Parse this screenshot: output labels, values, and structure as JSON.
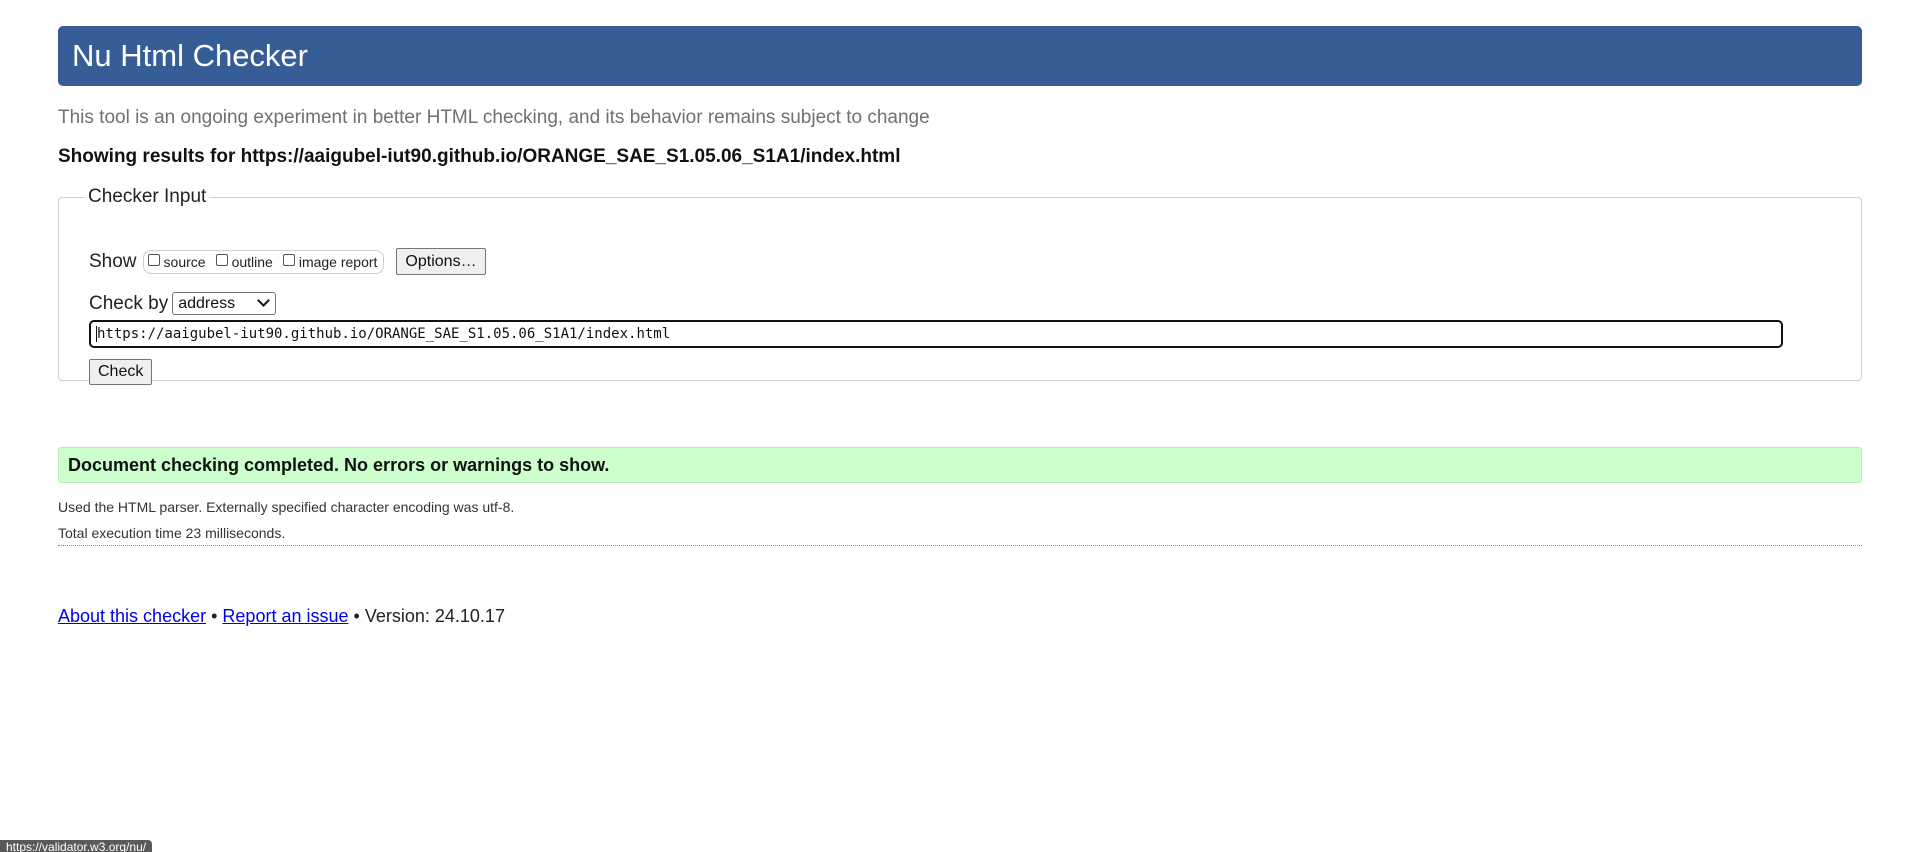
{
  "header": {
    "title": "Nu Html Checker"
  },
  "intro": "This tool is an ongoing experiment in better HTML checking, and its behavior remains subject to change",
  "results_heading": "Showing results for https://aaigubel-iut90.github.io/ORANGE_SAE_S1.05.06_S1A1/index.html",
  "checker_input": {
    "legend": "Checker Input",
    "show_label": "Show",
    "options": [
      {
        "label": "source",
        "checked": false
      },
      {
        "label": "outline",
        "checked": false
      },
      {
        "label": "image report",
        "checked": false
      }
    ],
    "options_button": "Options…",
    "check_by_label": "Check by",
    "check_by_value": "address",
    "url_value": "https://aaigubel-iut90.github.io/ORANGE_SAE_S1.05.06_S1A1/index.html",
    "check_button": "Check"
  },
  "result": {
    "message": "Document checking completed. No errors or warnings to show.",
    "parser_note": "Used the HTML parser. Externally specified character encoding was utf-8.",
    "time_note": "Total execution time 23 milliseconds."
  },
  "footer": {
    "about_link": "About this checker",
    "separator": "•",
    "report_link": "Report an issue",
    "version": "Version: 24.10.17"
  },
  "status_bar": {
    "url": "https://validator.w3.org/nu/"
  },
  "colors": {
    "header_bg": "#365d96",
    "success_bg": "#ccffcc",
    "link": "#0000ee"
  }
}
